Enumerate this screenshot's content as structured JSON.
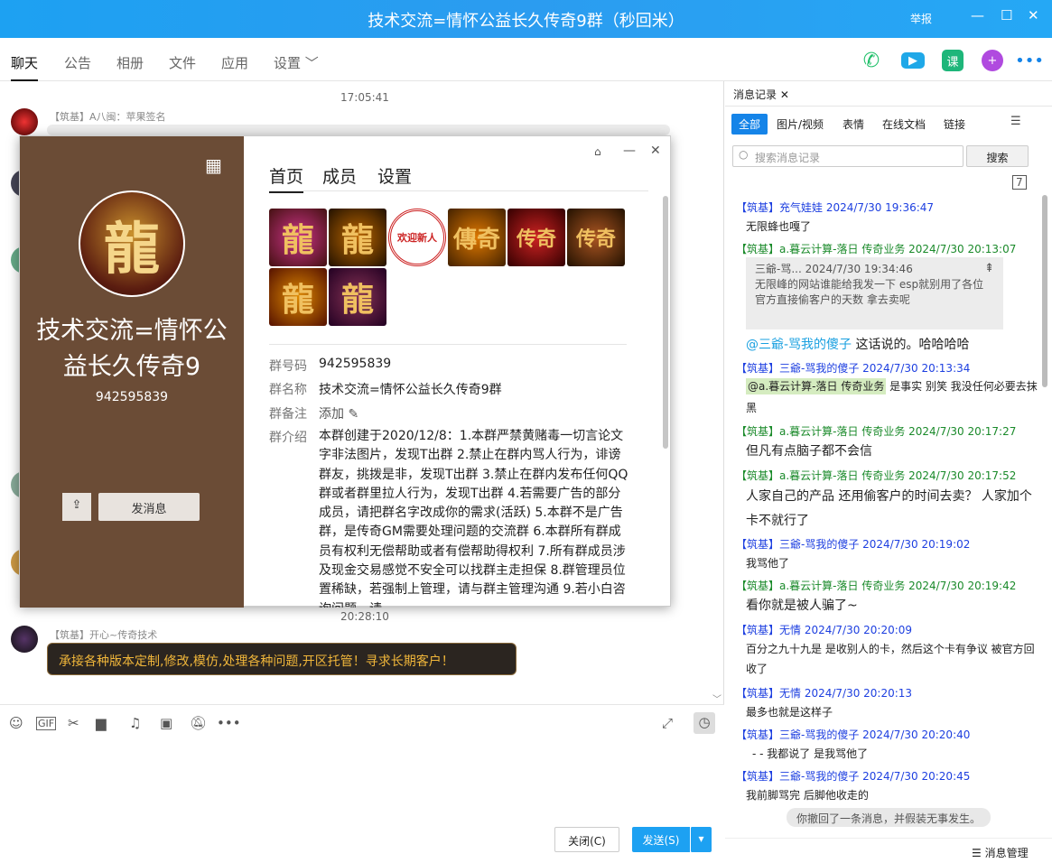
{
  "window": {
    "title": "技术交流=情怀公益长久传奇9群（秒回米）",
    "report": "举报",
    "controls": [
      "—",
      "☐",
      "✕"
    ]
  },
  "tabs": [
    "聊天",
    "公告",
    "相册",
    "文件",
    "应用",
    "设置 ﹀"
  ],
  "top_icons": [
    "phone-icon",
    "video-icon",
    "class-icon",
    "add-app-icon",
    "more-icon"
  ],
  "chat": {
    "time1": "17:05:41",
    "msg1_sender": "【筑基】A八闽：苹果签名",
    "time2": "20:28:10",
    "msg2_sender": "【筑基】开心~传奇技术",
    "msg2_text": "承接各种版本定制,修改,模仿,处理各种问题,开区托管！寻求长期客户！"
  },
  "input": {
    "close_label": "关闭(C)",
    "send_label": "发送(S)",
    "tool_icons": [
      "emoji-icon",
      "gif-icon",
      "screenshot-icon",
      "folder-icon",
      "music-icon",
      "image-icon",
      "mute-icon",
      "more-icon"
    ]
  },
  "group_popup": {
    "tabs": [
      "首页",
      "成员",
      "设置"
    ],
    "avatar_char": "龍",
    "name": "技术交流=情怀公益长久传奇9",
    "number": "942595839",
    "send_msg": "发消息",
    "thumbs": [
      "龍",
      "龍",
      "欢迎新人",
      "傳奇",
      "传奇",
      "传奇",
      "龍",
      "龍"
    ],
    "labels": {
      "number": "群号码",
      "name": "群名称",
      "remark": "群备注",
      "intro": "群介绍"
    },
    "values": {
      "number": "942595839",
      "name": "技术交流=情怀公益长久传奇9群",
      "remark": "添加 ✎"
    },
    "intro": "本群创建于2020/12/8：1.本群严禁黄赌毒一切言论文字非法图片，发现T出群 2.禁止在群内骂人行为，诽谤群友，挑拨是非，发现T出群 3.禁止在群内发布任何QQ群或者群里拉人行为，发现T出群 4.若需要广告的部分成员，请把群名字改成你的需求(活跃) 5.本群不是广告群，是传奇GM需要处理问题的交流群 6.本群所有群成员有权利无偿帮助或者有偿帮助得权利 7.所有群成员涉及现金交易感觉不安全可以找群主走担保 8.群管理员位置稀缺，若强制上管理，请与群主管理沟通 9.若小白咨询问题，请"
  },
  "history": {
    "tab_label": "消息记录 ✕",
    "filters": [
      "全部",
      "图片/视频",
      "表情",
      "在线文档",
      "链接"
    ],
    "search_placeholder": "搜索消息记录",
    "search_btn": "搜索",
    "quote": {
      "head": "三爺-骂...      2024/7/30 19:34:46",
      "text": "无限峰的网站谁能给我发一下  esp就别用了各位 官方直接偷客户的天数 拿去卖呢"
    },
    "items": [
      {
        "h": "【筑基】充气娃娃 2024/7/30 19:36:47",
        "c": "b",
        "t": "无限蜂也嘎了",
        "sm": true
      },
      {
        "h": "【筑基】a.暮云计算-落日 传奇业务 2024/7/30 20:13:07",
        "c": "g"
      },
      {
        "h": "",
        "t": "@三爺-骂我的傻子 这话说的。哈哈哈哈",
        "at": "@三爺-骂我的傻子"
      },
      {
        "h": "【筑基】三爺-骂我的傻子 2024/7/30 20:13:34",
        "c": "b"
      },
      {
        "h": "【筑基】a.暮云计算-落日 传奇业务 2024/7/30 20:17:27",
        "c": "g",
        "t": "但凡有点脑子都不会信"
      },
      {
        "h": "【筑基】a.暮云计算-落日 传奇业务 2024/7/30 20:17:52",
        "c": "g",
        "t": "人家自己的产品 还用偷客户的时间去卖？ 人家加个卡不就行了"
      },
      {
        "h": "【筑基】三爺-骂我的傻子 2024/7/30 20:19:02",
        "c": "b",
        "t": "我骂他了",
        "sm": true
      },
      {
        "h": "【筑基】a.暮云计算-落日 传奇业务 2024/7/30 20:19:42",
        "c": "g",
        "t": "看你就是被人骗了~"
      },
      {
        "h": "【筑基】无情 2024/7/30 20:20:09",
        "c": "b",
        "t": "百分之九十九是  是收别人的卡，然后这个卡有争议  被官方回收了",
        "sm": true
      },
      {
        "h": "【筑基】无情 2024/7/30 20:20:13",
        "c": "b",
        "t": "最多也就是这样子",
        "sm": true
      },
      {
        "h": "【筑基】三爺-骂我的傻子 2024/7/30 20:20:40",
        "c": "b",
        "t": "- - 我都说了 是我骂他了",
        "sm": true
      },
      {
        "h": "【筑基】三爺-骂我的傻子 2024/7/30 20:20:45",
        "c": "b",
        "t": "我前脚骂完 后脚他收走的",
        "sm": true
      }
    ],
    "reply_hl": "@a.暮云计算-落日 传奇业务",
    "reply_rest": " 是事实 别笑  我没任何必要去抹黑",
    "recall": "你撤回了一条消息，并假装无事发生。",
    "footer": "☰ 消息管理"
  }
}
